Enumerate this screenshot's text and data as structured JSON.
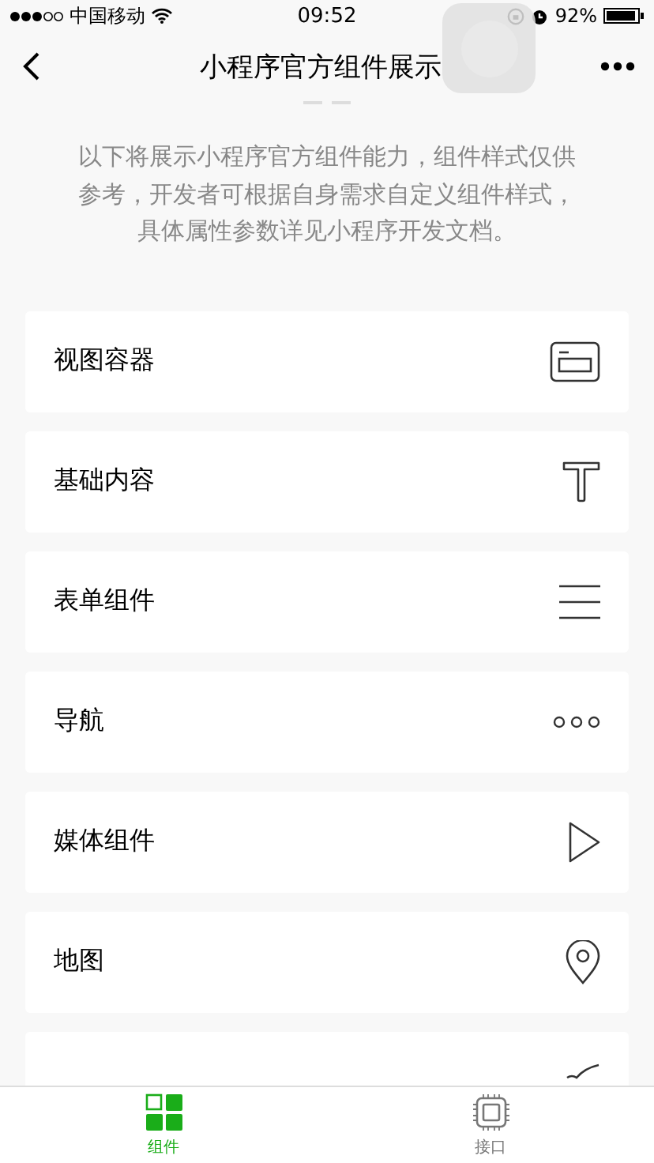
{
  "status_bar": {
    "carrier": "中国移动",
    "time": "09:52",
    "battery": "92%"
  },
  "nav": {
    "title": "小程序官方组件展示"
  },
  "intro": "以下将展示小程序官方组件能力，组件样式仅供参考，开发者可根据自身需求自定义组件样式，具体属性参数详见小程序开发文档。",
  "menu": [
    {
      "label": "视图容器",
      "kind": "view"
    },
    {
      "label": "基础内容",
      "kind": "text"
    },
    {
      "label": "表单组件",
      "kind": "form"
    },
    {
      "label": "导航",
      "kind": "nav"
    },
    {
      "label": "媒体组件",
      "kind": "media"
    },
    {
      "label": "地图",
      "kind": "map"
    },
    {
      "kind": "canvas"
    }
  ],
  "tabs": [
    {
      "label": "组件",
      "selected": true
    },
    {
      "label": "接口",
      "selected": false
    }
  ]
}
